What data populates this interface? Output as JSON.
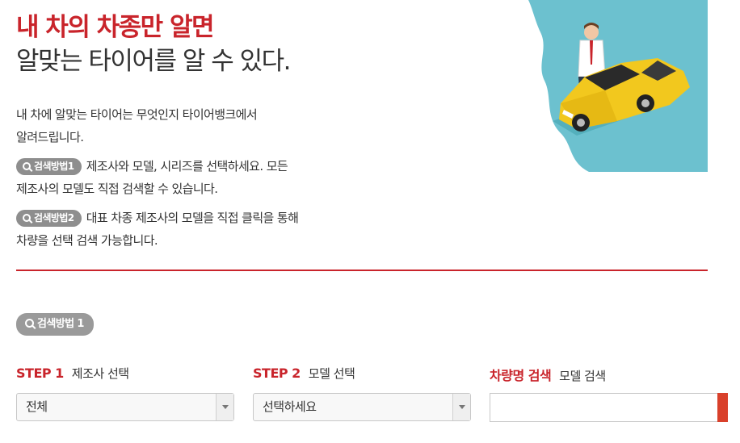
{
  "headline": {
    "line1": "내 차의 차종만 알면",
    "line2": "알맞는 타이어를 알 수 있다."
  },
  "intro": {
    "line1": "내 차에 알맞는 타이어는 무엇인지 타이어뱅크에서",
    "line2": "알려드립니다."
  },
  "methods": [
    {
      "badge": "검색방법1",
      "line1": "제조사와 모델, 시리즈를 선택하세요. 모든",
      "line2": "제조사의 모델도 직접 검색할 수 있습니다."
    },
    {
      "badge": "검색방법2",
      "line1": "대표 차종 제조사의 모델을 직접 클릭을 통해",
      "line2": "차량을 선택 검색 가능합니다."
    }
  ],
  "search_method_tag": "검색방법 1",
  "step1": {
    "key": "STEP 1",
    "label": "제조사 선택",
    "selected": "전체"
  },
  "step2": {
    "key": "STEP 2",
    "label": "모델 선택",
    "selected": "선택하세요"
  },
  "name_search": {
    "key": "차량명 검색",
    "label": "모델 검색",
    "value": ""
  },
  "colors": {
    "accent": "#c9242b",
    "badge": "#8e8e8e",
    "illustration_bg": "#6cc1cf",
    "car": "#f2c81e"
  },
  "icons": [
    "search-icon",
    "dropdown-arrow-icon"
  ]
}
